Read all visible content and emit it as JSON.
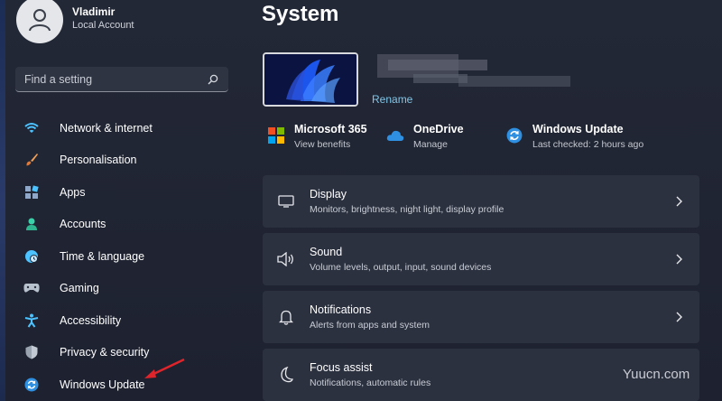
{
  "profile": {
    "name": "Vladimir",
    "account_type": "Local Account"
  },
  "search": {
    "placeholder": "Find a setting"
  },
  "nav": [
    {
      "label": "Network & internet",
      "icon": "wifi-icon"
    },
    {
      "label": "Personalisation",
      "icon": "brush-icon"
    },
    {
      "label": "Apps",
      "icon": "apps-icon"
    },
    {
      "label": "Accounts",
      "icon": "person-icon"
    },
    {
      "label": "Time & language",
      "icon": "globe-clock-icon"
    },
    {
      "label": "Gaming",
      "icon": "gamepad-icon"
    },
    {
      "label": "Accessibility",
      "icon": "accessibility-icon"
    },
    {
      "label": "Privacy & security",
      "icon": "shield-icon"
    },
    {
      "label": "Windows Update",
      "icon": "update-icon"
    }
  ],
  "main": {
    "title": "System",
    "device": {
      "rename_label": "Rename"
    },
    "quick_links": [
      {
        "title": "Microsoft 365",
        "subtitle": "View benefits",
        "icon": "microsoft-logo-icon"
      },
      {
        "title": "OneDrive",
        "subtitle": "Manage",
        "icon": "cloud-icon"
      },
      {
        "title": "Windows Update",
        "subtitle": "Last checked: 2 hours ago",
        "icon": "update-icon"
      }
    ],
    "cards": [
      {
        "title": "Display",
        "subtitle": "Monitors, brightness, night light, display profile",
        "icon": "monitor-icon"
      },
      {
        "title": "Sound",
        "subtitle": "Volume levels, output, input, sound devices",
        "icon": "speaker-icon"
      },
      {
        "title": "Notifications",
        "subtitle": "Alerts from apps and system",
        "icon": "bell-icon"
      },
      {
        "title": "Focus assist",
        "subtitle": "Notifications, automatic rules",
        "icon": "moon-icon"
      }
    ]
  },
  "watermark": "Yuucn.com",
  "colors": {
    "accent": "#4cc2ff",
    "link": "#7fc6e8",
    "annotation_arrow": "#e0242b"
  }
}
